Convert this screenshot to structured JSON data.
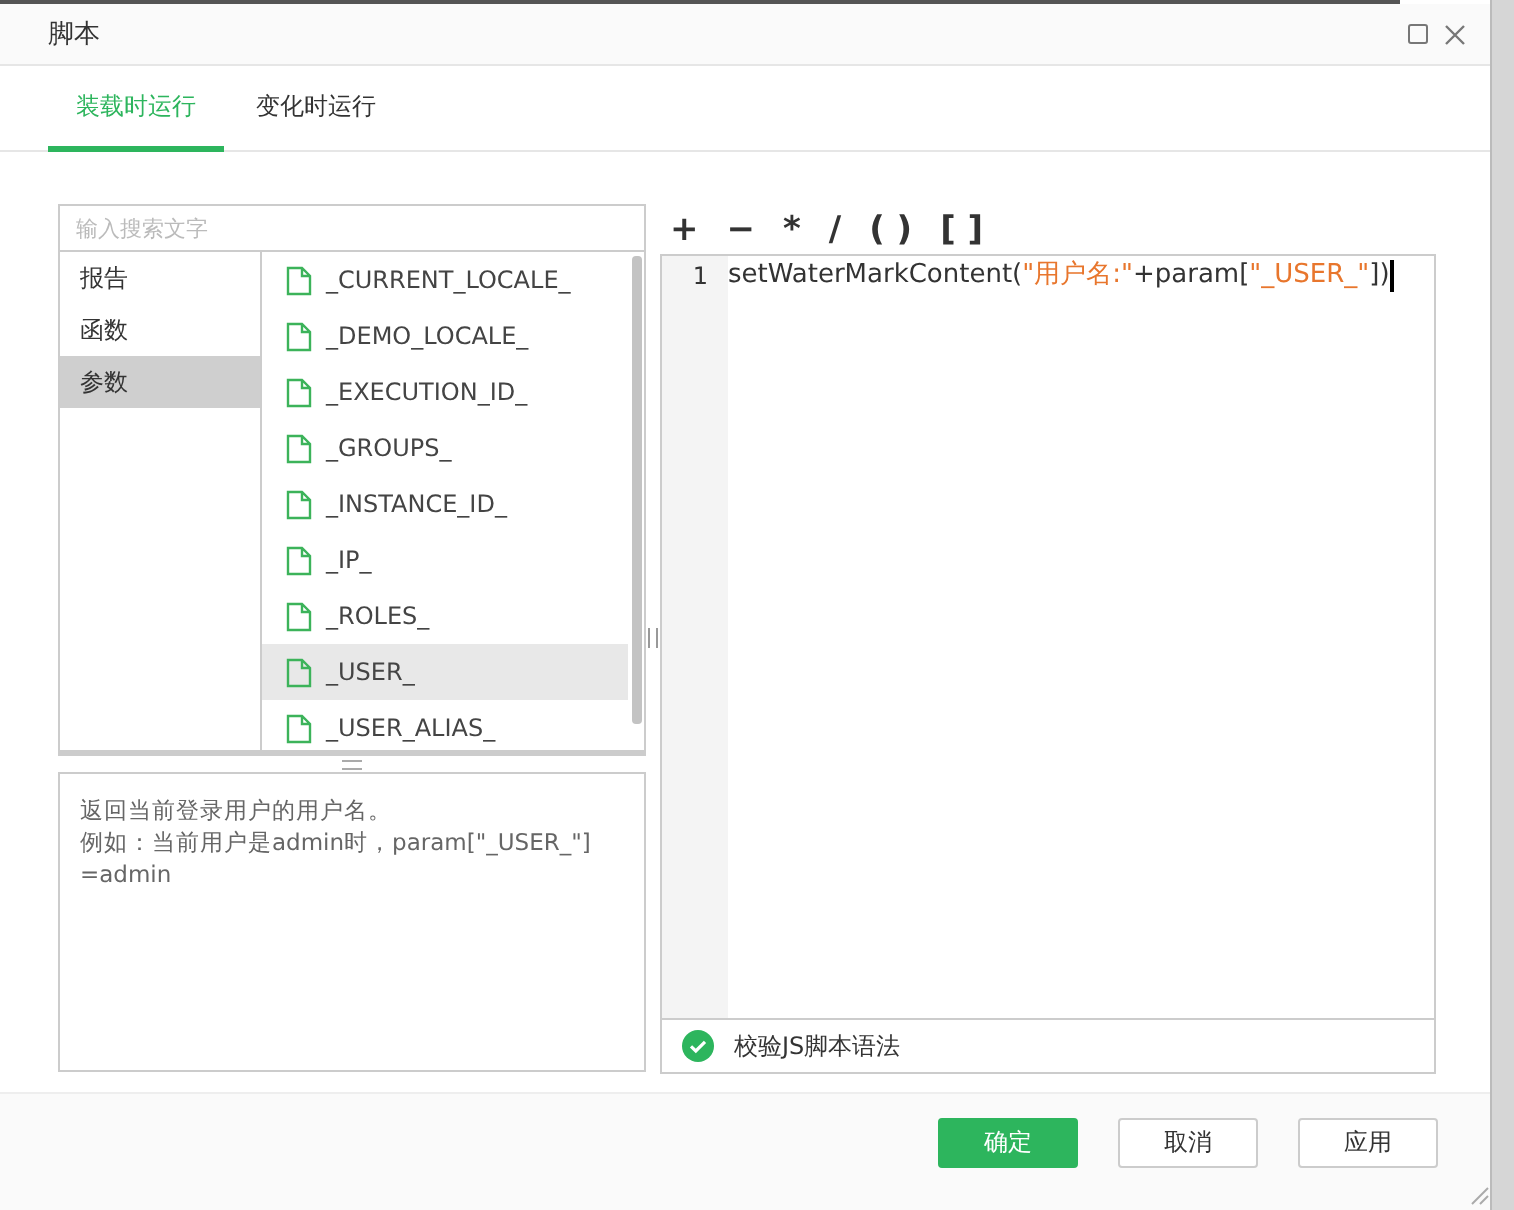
{
  "window": {
    "title": "脚本"
  },
  "tabs": [
    {
      "label": "装载时运行",
      "selected": true
    },
    {
      "label": "变化时运行",
      "selected": false
    }
  ],
  "search": {
    "placeholder": "输入搜索文字"
  },
  "categories": [
    {
      "label": "报告",
      "selected": false
    },
    {
      "label": "函数",
      "selected": false
    },
    {
      "label": "参数",
      "selected": true
    }
  ],
  "items": [
    {
      "label": "_CURRENT_LOCALE_",
      "selected": false
    },
    {
      "label": "_DEMO_LOCALE_",
      "selected": false
    },
    {
      "label": "_EXECUTION_ID_",
      "selected": false
    },
    {
      "label": "_GROUPS_",
      "selected": false
    },
    {
      "label": "_INSTANCE_ID_",
      "selected": false
    },
    {
      "label": "_IP_",
      "selected": false
    },
    {
      "label": "_ROLES_",
      "selected": false
    },
    {
      "label": "_USER_",
      "selected": true
    },
    {
      "label": "_USER_ALIAS_",
      "selected": false
    }
  ],
  "description": [
    "返回当前登录用户的用户名。",
    "例如：当前用户是admin时，param[\"_USER_\"]",
    "=admin"
  ],
  "operators": [
    "+",
    "−",
    "*",
    "/",
    "( )",
    "[ ]"
  ],
  "editor": {
    "lines": [
      {
        "number": "1",
        "tokens": [
          {
            "kind": "plain",
            "text": "setWaterMarkContent("
          },
          {
            "kind": "string",
            "text": "\"用户名:\""
          },
          {
            "kind": "plain",
            "text": "+param["
          },
          {
            "kind": "string",
            "text": "\"_USER_\""
          },
          {
            "kind": "plain",
            "text": "])"
          }
        ]
      }
    ],
    "validation": {
      "label": "校验JS脚本语法",
      "valid": true
    }
  },
  "buttons": [
    {
      "label": "确定",
      "kind": "primary"
    },
    {
      "label": "取消",
      "kind": "default"
    },
    {
      "label": "应用",
      "kind": "default"
    }
  ]
}
